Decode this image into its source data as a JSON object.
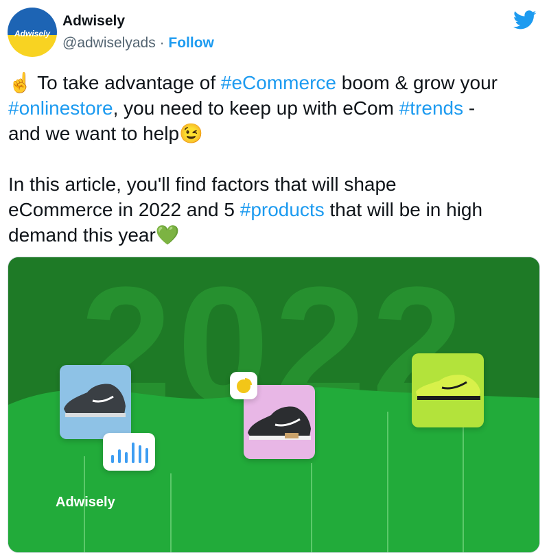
{
  "author": {
    "avatar_text": "Adwisely",
    "name": "Adwisely",
    "handle": "@adwiselyads",
    "separator": "·",
    "follow_label": "Follow"
  },
  "tweet": {
    "emoji_start": "☝️",
    "text_1": " To take advantage of ",
    "hashtag_ecommerce": "#eCommerce",
    "text_2": " boom & grow your\n",
    "hashtag_onlinestore": "#onlinestore",
    "text_3": ", you need to keep up with eCom ",
    "hashtag_trends": "#trends",
    "text_4": " -\nand we want to help",
    "emoji_wink": "😉",
    "text_5": "\n\nIn this article, you'll find factors that will shape\neCommerce in 2022 and 5 ",
    "hashtag_products": "#products",
    "text_6": " that will be in high\ndemand this year",
    "emoji_heart": "💚"
  },
  "media": {
    "big_year": "2022",
    "watermark": "Adwisely"
  },
  "colors": {
    "accent": "#1d9bf0",
    "text": "#0f1419",
    "muted": "#536471",
    "bg_green_dark": "#1e7a26",
    "bg_green_light": "#22ab3a",
    "card_blue": "#8ec2e6",
    "card_pink": "#e8b7e6",
    "card_lime": "#b3e33b"
  }
}
